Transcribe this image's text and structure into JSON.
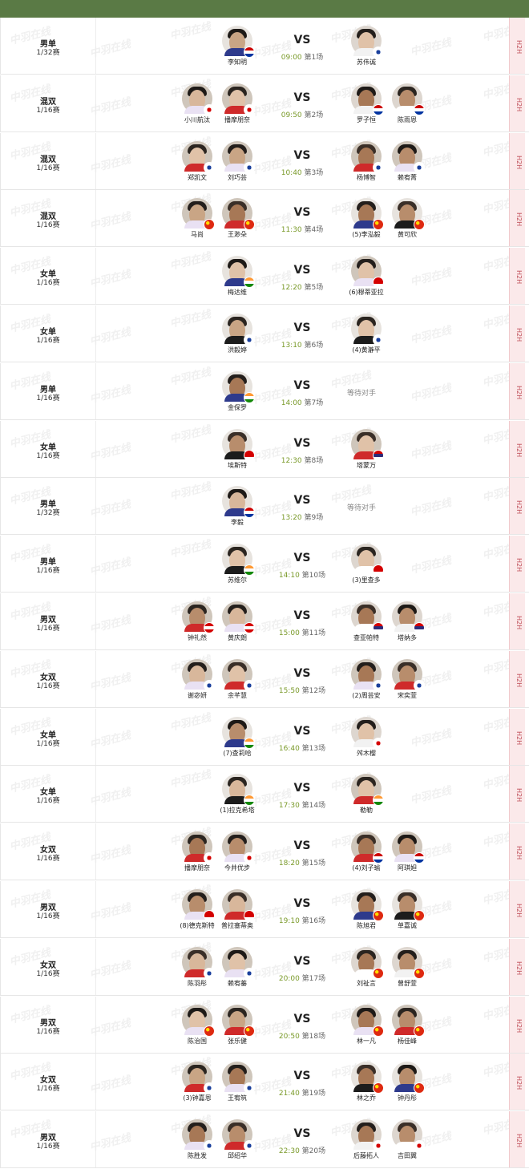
{
  "matches": [
    {
      "event": "男单",
      "round": "1/32赛",
      "time": "09:00",
      "court": "第1场",
      "left": [
        {
          "name": "李知明",
          "flag": "mas"
        }
      ],
      "right": [
        {
          "name": "苏伟诚",
          "flag": "tpe"
        }
      ]
    },
    {
      "event": "混双",
      "round": "1/16赛",
      "time": "09:50",
      "court": "第2场",
      "left": [
        {
          "name": "小川航汰",
          "flag": "jpn"
        },
        {
          "name": "播摩朋奈",
          "flag": "jpn"
        }
      ],
      "right": [
        {
          "name": "罗子恒",
          "flag": "mas"
        },
        {
          "name": "陈雨恩",
          "flag": "mas"
        }
      ]
    },
    {
      "event": "混双",
      "round": "1/16赛",
      "time": "10:40",
      "court": "第3场",
      "left": [
        {
          "name": "郑凯文",
          "flag": "tpe"
        },
        {
          "name": "刘巧芸",
          "flag": "tpe"
        }
      ],
      "right": [
        {
          "name": "杨博智",
          "flag": "tpe"
        },
        {
          "name": "赖宥菁",
          "flag": "tpe"
        }
      ]
    },
    {
      "event": "混双",
      "round": "1/16赛",
      "time": "11:30",
      "court": "第4场",
      "left": [
        {
          "name": "马尚",
          "flag": "chn"
        },
        {
          "name": "王渺朵",
          "flag": "chn"
        }
      ],
      "right": [
        {
          "name": "(5)李泓毅",
          "flag": "chn"
        },
        {
          "name": "黄可欣",
          "flag": "chn"
        }
      ]
    },
    {
      "event": "女单",
      "round": "1/16赛",
      "time": "12:20",
      "court": "第5场",
      "left": [
        {
          "name": "梅达维",
          "flag": "ind"
        }
      ],
      "right": [
        {
          "name": "(6)穆蒂亚拉",
          "flag": "ina"
        }
      ]
    },
    {
      "event": "女单",
      "round": "1/16赛",
      "time": "13:10",
      "court": "第6场",
      "left": [
        {
          "name": "洪毅婷",
          "flag": "tpe"
        }
      ],
      "right": [
        {
          "name": "(4)黄瀞平",
          "flag": "tpe"
        }
      ]
    },
    {
      "event": "男单",
      "round": "1/16赛",
      "time": "14:00",
      "court": "第7场",
      "left": [
        {
          "name": "金保罗",
          "flag": "ind"
        }
      ],
      "right": [],
      "waiting": "等待对手"
    },
    {
      "event": "女单",
      "round": "1/16赛",
      "time": "12:30",
      "court": "第8场",
      "left": [
        {
          "name": "埃斯特",
          "flag": "ina"
        }
      ],
      "right": [
        {
          "name": "塔蒙万",
          "flag": "tha"
        }
      ]
    },
    {
      "event": "男单",
      "round": "1/32赛",
      "time": "13:20",
      "court": "第9场",
      "left": [
        {
          "name": "李毅",
          "flag": "mas"
        }
      ],
      "right": [],
      "waiting": "等待对手"
    },
    {
      "event": "男单",
      "round": "1/16赛",
      "time": "14:10",
      "court": "第10场",
      "left": [
        {
          "name": "苏维尔",
          "flag": "ind"
        }
      ],
      "right": [
        {
          "name": "(3)里查多",
          "flag": "ina"
        }
      ]
    },
    {
      "event": "男双",
      "round": "1/16赛",
      "time": "15:00",
      "court": "第11场",
      "left": [
        {
          "name": "钟礼然",
          "flag": "can"
        },
        {
          "name": "黄庆朗",
          "flag": "can"
        }
      ],
      "right": [
        {
          "name": "查亚帕特",
          "flag": "tha"
        },
        {
          "name": "塔纳多",
          "flag": "tha"
        }
      ]
    },
    {
      "event": "女双",
      "round": "1/16赛",
      "time": "15:50",
      "court": "第12场",
      "left": [
        {
          "name": "谢宓妍",
          "flag": "tpe"
        },
        {
          "name": "余芊慧",
          "flag": "tpe"
        }
      ],
      "right": [
        {
          "name": "(2)周芸安",
          "flag": "tpe"
        },
        {
          "name": "宋奕萱",
          "flag": "tpe"
        }
      ]
    },
    {
      "event": "女单",
      "round": "1/16赛",
      "time": "16:40",
      "court": "第13场",
      "left": [
        {
          "name": "(7)查莉哈",
          "flag": "ind"
        }
      ],
      "right": [
        {
          "name": "舛木樱",
          "flag": "jpn"
        }
      ]
    },
    {
      "event": "女单",
      "round": "1/16赛",
      "time": "17:30",
      "court": "第14场",
      "left": [
        {
          "name": "(1)拉克希塔",
          "flag": "ind"
        }
      ],
      "right": [
        {
          "name": "勒勒",
          "flag": "ind"
        }
      ]
    },
    {
      "event": "女双",
      "round": "1/16赛",
      "time": "18:20",
      "court": "第15场",
      "left": [
        {
          "name": "播摩朋奈",
          "flag": "jpn"
        },
        {
          "name": "今井优步",
          "flag": "jpn"
        }
      ],
      "right": [
        {
          "name": "(4)刘子瑜",
          "flag": "mas"
        },
        {
          "name": "阿琪妲",
          "flag": "mas"
        }
      ]
    },
    {
      "event": "男双",
      "round": "1/16赛",
      "time": "19:10",
      "court": "第16场",
      "left": [
        {
          "name": "(8)德克斯特",
          "flag": "ina"
        },
        {
          "name": "普拉塞蒂奥",
          "flag": "ina"
        }
      ],
      "right": [
        {
          "name": "陈旭君",
          "flag": "chn"
        },
        {
          "name": "单嘉诚",
          "flag": "chn"
        }
      ]
    },
    {
      "event": "女双",
      "round": "1/16赛",
      "time": "20:00",
      "court": "第17场",
      "left": [
        {
          "name": "陈羽彤",
          "flag": "tpe"
        },
        {
          "name": "赖宥蓁",
          "flag": "tpe"
        }
      ],
      "right": [
        {
          "name": "刘祉言",
          "flag": "chn"
        },
        {
          "name": "曾舒萱",
          "flag": "chn"
        }
      ]
    },
    {
      "event": "男双",
      "round": "1/16赛",
      "time": "20:50",
      "court": "第18场",
      "left": [
        {
          "name": "陈治国",
          "flag": "chn"
        },
        {
          "name": "张乐健",
          "flag": "chn"
        }
      ],
      "right": [
        {
          "name": "林一凡",
          "flag": "chn"
        },
        {
          "name": "杨佳峰",
          "flag": "chn"
        }
      ]
    },
    {
      "event": "女双",
      "round": "1/16赛",
      "time": "21:40",
      "court": "第19场",
      "left": [
        {
          "name": "(3)钟嘉恩",
          "flag": "tpe"
        },
        {
          "name": "王宥筑",
          "flag": "tpe"
        }
      ],
      "right": [
        {
          "name": "林之乔",
          "flag": "chn"
        },
        {
          "name": "钟丹彤",
          "flag": "chn"
        }
      ]
    },
    {
      "event": "男双",
      "round": "1/16赛",
      "time": "22:30",
      "court": "第20场",
      "left": [
        {
          "name": "陈胜发",
          "flag": "tpe"
        },
        {
          "name": "邱绍华",
          "flag": "tpe"
        }
      ],
      "right": [
        {
          "name": "后藤拓人",
          "flag": "jpn"
        },
        {
          "name": "吉田翼",
          "flag": "jpn"
        }
      ]
    }
  ],
  "vs_label": "VS",
  "h2h_label": "H2H",
  "watermark": "中羽在线",
  "flag_colors": {
    "mas": [
      "#cc0000",
      "#ffffff",
      "#0033a0"
    ],
    "tpe": [
      "#ffffff",
      "#e8e8e8",
      "#1a3f9c"
    ],
    "jpn": [
      "#ffffff",
      "#ffffff",
      "#d40000"
    ],
    "chn": [
      "#de2910",
      "#de2910",
      "#ffde00"
    ],
    "ind": [
      "#ff9933",
      "#ffffff",
      "#138808"
    ],
    "ina": [
      "#d40000",
      "#d40000",
      "#ffffff"
    ],
    "tha": [
      "#d40000",
      "#2d2a78",
      "#ffffff"
    ],
    "can": [
      "#d40000",
      "#ffffff",
      "#d40000"
    ]
  }
}
